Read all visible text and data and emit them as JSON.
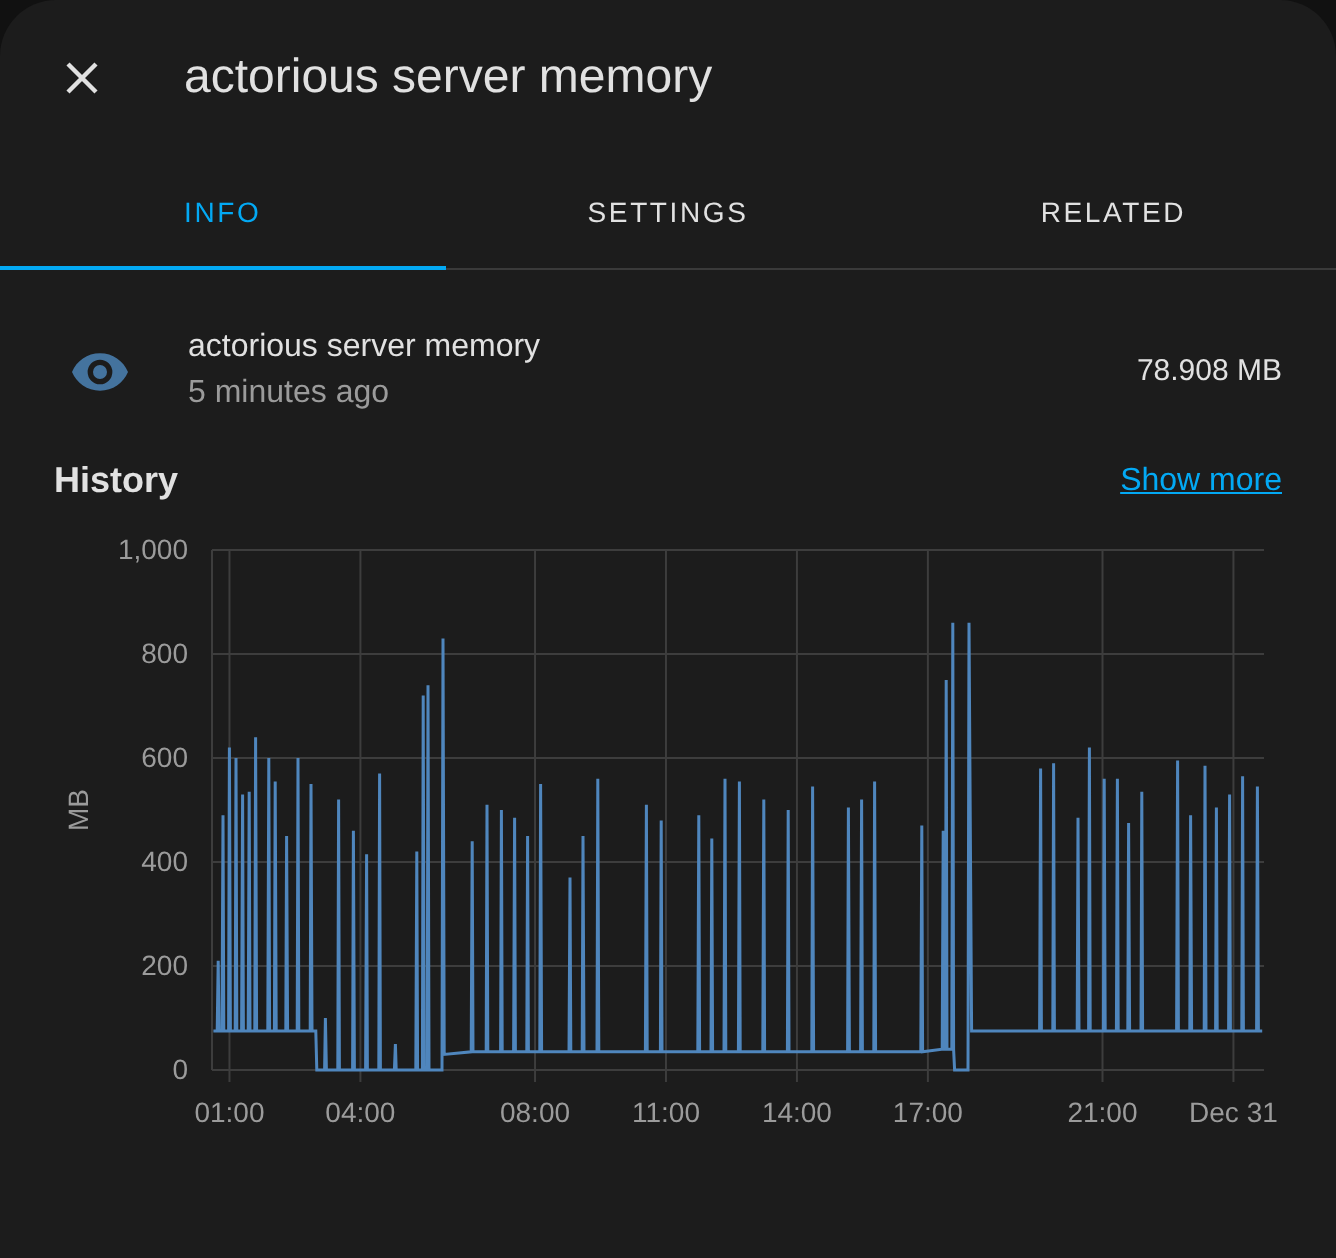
{
  "header": {
    "title": "actorious server memory"
  },
  "tabs": [
    {
      "label": "INFO",
      "selected": true
    },
    {
      "label": "SETTINGS",
      "selected": false
    },
    {
      "label": "RELATED",
      "selected": false
    }
  ],
  "entity": {
    "name": "actorious server memory",
    "last_changed": "5 minutes ago",
    "state": "78.908 MB"
  },
  "history": {
    "title": "History",
    "link": "Show more",
    "chart_data": {
      "type": "line",
      "grid": true,
      "ylabel": "MB",
      "x": [
        0.63,
        0.72,
        0.74,
        0.76,
        0.83,
        0.85,
        0.87,
        0.98,
        1.0,
        1.02,
        1.13,
        1.15,
        1.17,
        1.28,
        1.3,
        1.32,
        1.43,
        1.45,
        1.47,
        1.58,
        1.6,
        1.62,
        1.88,
        1.9,
        1.92,
        2.03,
        2.05,
        2.07,
        2.29,
        2.31,
        2.33,
        2.55,
        2.57,
        2.59,
        2.85,
        2.87,
        2.89,
        2.98,
        3.0,
        3.18,
        3.2,
        3.22,
        3.48,
        3.5,
        3.52,
        3.82,
        3.84,
        3.86,
        4.12,
        4.14,
        4.16,
        4.42,
        4.44,
        4.46,
        4.78,
        4.8,
        4.82,
        5.27,
        5.29,
        5.31,
        5.42,
        5.44,
        5.46,
        5.53,
        5.55,
        5.57,
        5.63,
        5.87,
        5.89,
        5.92,
        6.54,
        6.56,
        6.58,
        6.88,
        6.9,
        6.92,
        7.21,
        7.23,
        7.25,
        7.51,
        7.53,
        7.55,
        7.81,
        7.83,
        7.85,
        8.11,
        8.13,
        8.15,
        8.78,
        8.8,
        8.82,
        9.08,
        9.1,
        9.12,
        9.42,
        9.44,
        9.46,
        10.53,
        10.55,
        10.57,
        10.87,
        10.89,
        10.91,
        11.73,
        11.75,
        11.77,
        12.03,
        12.05,
        12.07,
        12.33,
        12.35,
        12.37,
        12.66,
        12.68,
        12.7,
        13.22,
        13.24,
        13.26,
        13.78,
        13.8,
        13.82,
        14.34,
        14.36,
        14.38,
        15.16,
        15.18,
        15.2,
        15.46,
        15.48,
        15.5,
        15.76,
        15.78,
        15.8,
        16.84,
        16.86,
        16.88,
        17.33,
        17.35,
        17.37,
        17.4,
        17.42,
        17.44,
        17.55,
        17.57,
        17.59,
        17.61,
        17.92,
        17.94,
        18.0,
        19.56,
        19.58,
        19.6,
        19.86,
        19.88,
        19.9,
        20.42,
        20.44,
        20.46,
        20.68,
        20.7,
        20.72,
        21.02,
        21.04,
        21.06,
        21.32,
        21.34,
        21.36,
        21.58,
        21.6,
        21.62,
        21.88,
        21.9,
        21.92,
        22.7,
        22.72,
        22.74,
        23.0,
        23.02,
        23.04,
        23.33,
        23.35,
        23.37,
        23.59,
        23.61,
        23.63,
        23.89,
        23.91,
        23.93,
        24.19,
        24.21,
        24.23,
        24.53,
        24.55,
        24.57,
        24.66
      ],
      "series": [
        {
          "color": "#4f86bd",
          "values": [
            75,
            75,
            210,
            75,
            75,
            490,
            75,
            75,
            620,
            75,
            75,
            600,
            75,
            75,
            530,
            75,
            75,
            535,
            75,
            75,
            640,
            75,
            75,
            600,
            75,
            75,
            555,
            75,
            75,
            450,
            75,
            75,
            600,
            75,
            75,
            550,
            75,
            75,
            0,
            0,
            100,
            0,
            0,
            520,
            0,
            0,
            460,
            0,
            0,
            415,
            0,
            0,
            570,
            0,
            0,
            50,
            0,
            0,
            420,
            0,
            0,
            720,
            0,
            0,
            740,
            0,
            0,
            0,
            830,
            30,
            35,
            440,
            35,
            35,
            510,
            35,
            35,
            500,
            35,
            35,
            485,
            35,
            35,
            450,
            35,
            35,
            550,
            35,
            35,
            370,
            35,
            35,
            450,
            35,
            35,
            560,
            35,
            35,
            510,
            35,
            35,
            480,
            35,
            35,
            490,
            35,
            35,
            445,
            35,
            35,
            560,
            35,
            35,
            555,
            35,
            35,
            520,
            35,
            35,
            500,
            35,
            35,
            545,
            35,
            35,
            505,
            35,
            35,
            520,
            35,
            35,
            555,
            35,
            35,
            470,
            35,
            40,
            460,
            40,
            40,
            750,
            40,
            40,
            860,
            40,
            0,
            0,
            860,
            75,
            75,
            580,
            75,
            75,
            590,
            75,
            75,
            485,
            75,
            75,
            620,
            75,
            75,
            560,
            75,
            75,
            560,
            75,
            75,
            475,
            75,
            75,
            535,
            75,
            75,
            595,
            75,
            75,
            490,
            75,
            75,
            585,
            75,
            75,
            505,
            75,
            75,
            530,
            75,
            75,
            565,
            75,
            75,
            545,
            75,
            75
          ]
        }
      ],
      "xlim": [
        0.6,
        24.7
      ],
      "ylim": [
        0,
        1000
      ],
      "xticks": [
        {
          "value": 1,
          "label": "01:00"
        },
        {
          "value": 4,
          "label": "04:00"
        },
        {
          "value": 8,
          "label": "08:00"
        },
        {
          "value": 11,
          "label": "11:00"
        },
        {
          "value": 14,
          "label": "14:00"
        },
        {
          "value": 17,
          "label": "17:00"
        },
        {
          "value": 21,
          "label": "21:00"
        },
        {
          "value": 24,
          "label": "Dec 31"
        }
      ],
      "yticks": [
        {
          "value": 0,
          "label": "0"
        },
        {
          "value": 200,
          "label": "200"
        },
        {
          "value": 400,
          "label": "400"
        },
        {
          "value": 600,
          "label": "600"
        },
        {
          "value": 800,
          "label": "800"
        },
        {
          "value": 1000,
          "label": "1,000"
        }
      ]
    }
  }
}
